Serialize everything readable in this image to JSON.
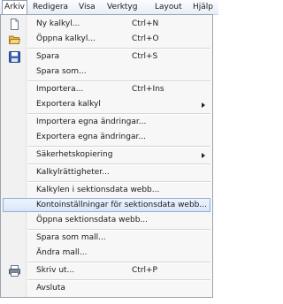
{
  "menubar": {
    "items": [
      {
        "label": "Arkiv",
        "active": true
      },
      {
        "label": "Redigera",
        "active": false
      },
      {
        "label": "Visa",
        "active": false
      },
      {
        "label": "Verktyg",
        "active": false
      },
      {
        "label": "Layout",
        "active": false
      },
      {
        "label": "Hjälp",
        "active": false
      }
    ]
  },
  "file_menu": {
    "items": [
      {
        "label": "Ny kalkyl...",
        "shortcut": "Ctrl+N",
        "icon": "new-document-icon"
      },
      {
        "label": "Öppna kalkyl...",
        "shortcut": "Ctrl+O",
        "icon": "open-folder-icon"
      },
      {
        "label": "Spara",
        "shortcut": "Ctrl+S",
        "icon": "floppy-disk-icon"
      },
      {
        "label": "Spara som...",
        "shortcut": ""
      },
      {
        "label": "Importera...",
        "shortcut": "Ctrl+Ins"
      },
      {
        "label": "Exportera kalkyl",
        "shortcut": "",
        "submenu": true
      },
      {
        "label": "Importera egna ändringar...",
        "shortcut": ""
      },
      {
        "label": "Exportera egna ändringar...",
        "shortcut": ""
      },
      {
        "label": "Säkerhetskopiering",
        "shortcut": "",
        "submenu": true
      },
      {
        "label": "Kalkylrättigheter...",
        "shortcut": ""
      },
      {
        "label": "Kalkylen i sektionsdata webb...",
        "shortcut": ""
      },
      {
        "label": "Kontoinställningar för sektionsdata webb...",
        "shortcut": "",
        "highlighted": true
      },
      {
        "label": "Öppna sektionsdata webb...",
        "shortcut": ""
      },
      {
        "label": "Spara som mall...",
        "shortcut": ""
      },
      {
        "label": "Ändra mall...",
        "shortcut": ""
      },
      {
        "label": "Skriv ut...",
        "shortcut": "Ctrl+P",
        "icon": "printer-icon"
      },
      {
        "label": "Avsluta",
        "shortcut": ""
      }
    ]
  }
}
